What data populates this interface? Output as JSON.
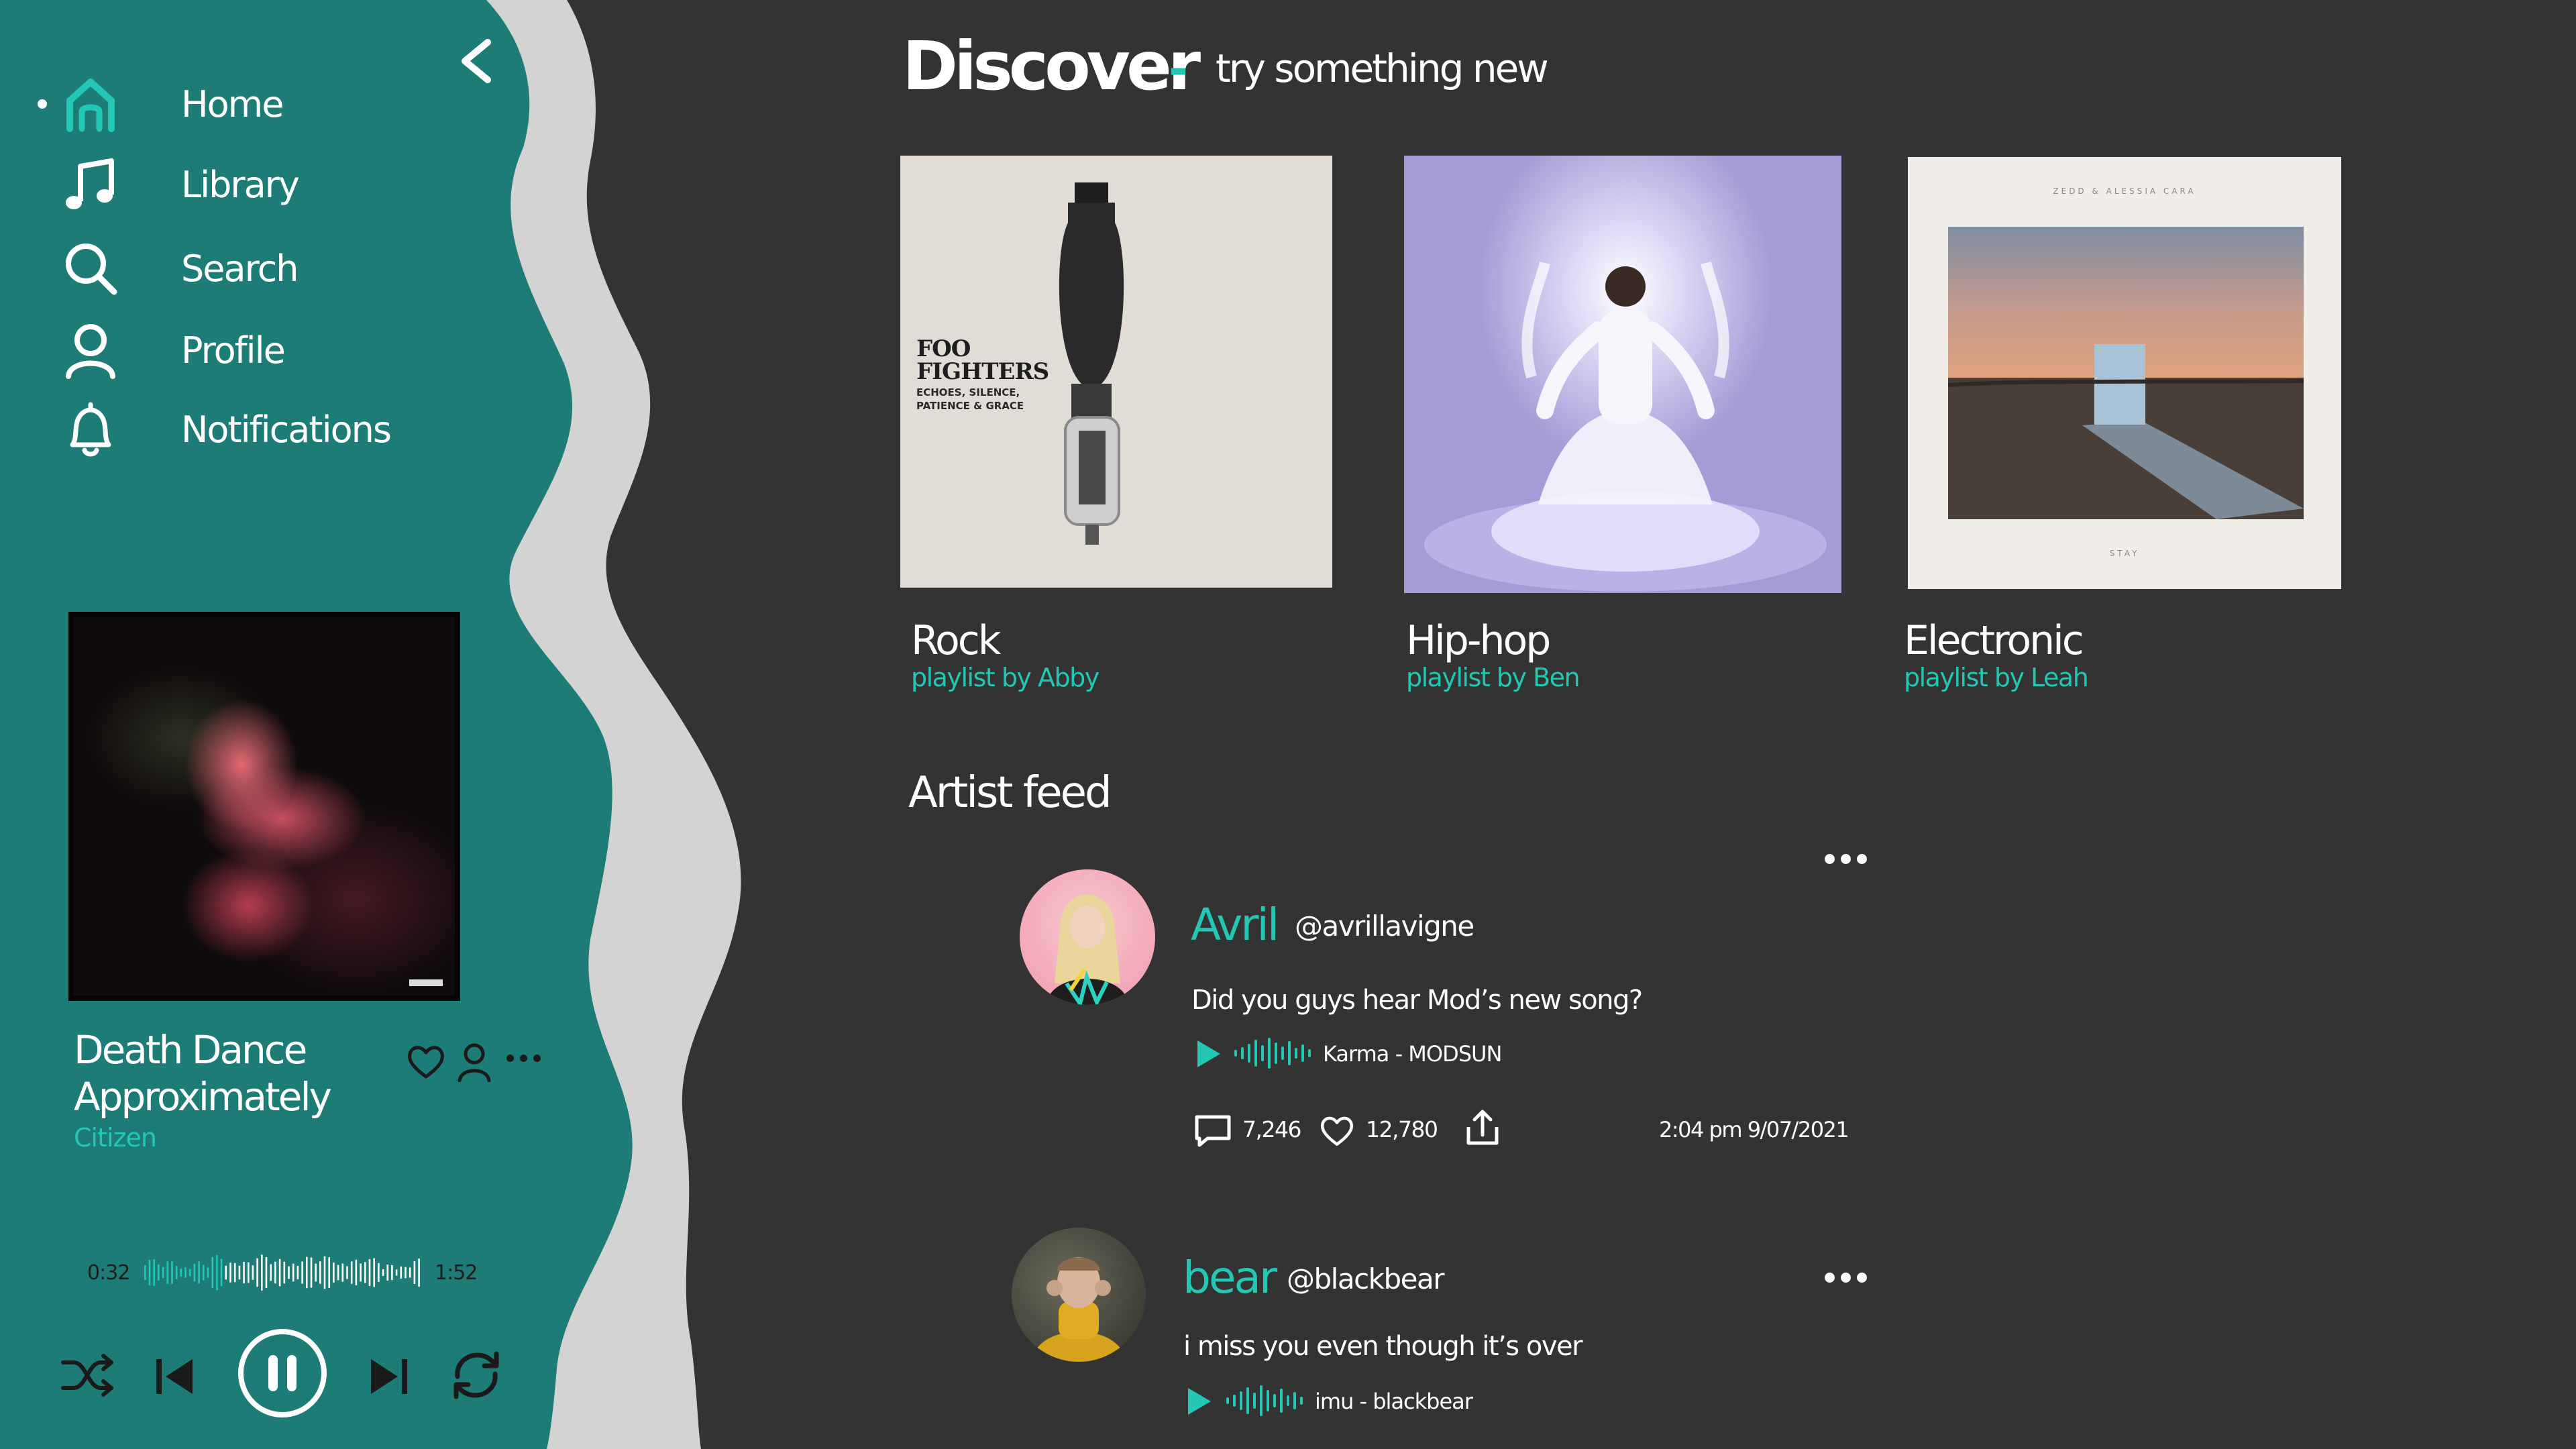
{
  "colors": {
    "accent": "#23c7b3",
    "sidebar": "#1e7c76",
    "wave": "#d3d3d3",
    "background": "#333333"
  },
  "nav": {
    "items": [
      {
        "label": "Home",
        "icon": "home-icon",
        "active": true
      },
      {
        "label": "Library",
        "icon": "music-note-icon"
      },
      {
        "label": "Search",
        "icon": "search-icon"
      },
      {
        "label": "Profile",
        "icon": "user-icon"
      },
      {
        "label": "Notifications",
        "icon": "bell-icon"
      }
    ]
  },
  "player": {
    "title": "Death Dance Approximately",
    "artist": "Citizen",
    "elapsed": "0:32",
    "duration": "1:52",
    "progress": 0.29,
    "state": "playing"
  },
  "discover": {
    "title": "Discover",
    "separator": "-",
    "subtitle": "try something new",
    "playlists": [
      {
        "genre": "Rock",
        "by": "playlist by Abby",
        "cover_text": [
          "FOO",
          "FIGHTERS",
          "ECHOES, SILENCE,",
          "PATIENCE & GRACE"
        ]
      },
      {
        "genre": "Hip-hop",
        "by": "playlist by Ben"
      },
      {
        "genre": "Electronic",
        "by": "playlist by Leah",
        "cover_text": [
          "ZEDD & ALESSIA CARA",
          "STAY"
        ]
      }
    ]
  },
  "feed": {
    "title": "Artist feed",
    "posts": [
      {
        "name": "Avril",
        "handle": "@avrillavigne",
        "text": "Did you guys hear Mod’s new song?",
        "song": "Karma - MODSUN",
        "comments": "7,246",
        "likes": "12,780",
        "time": "2:04 pm 9/07/2021"
      },
      {
        "name": "bear",
        "handle": "@blackbear",
        "text": "i miss you even though it’s over",
        "song": "imu - blackbear"
      }
    ]
  }
}
